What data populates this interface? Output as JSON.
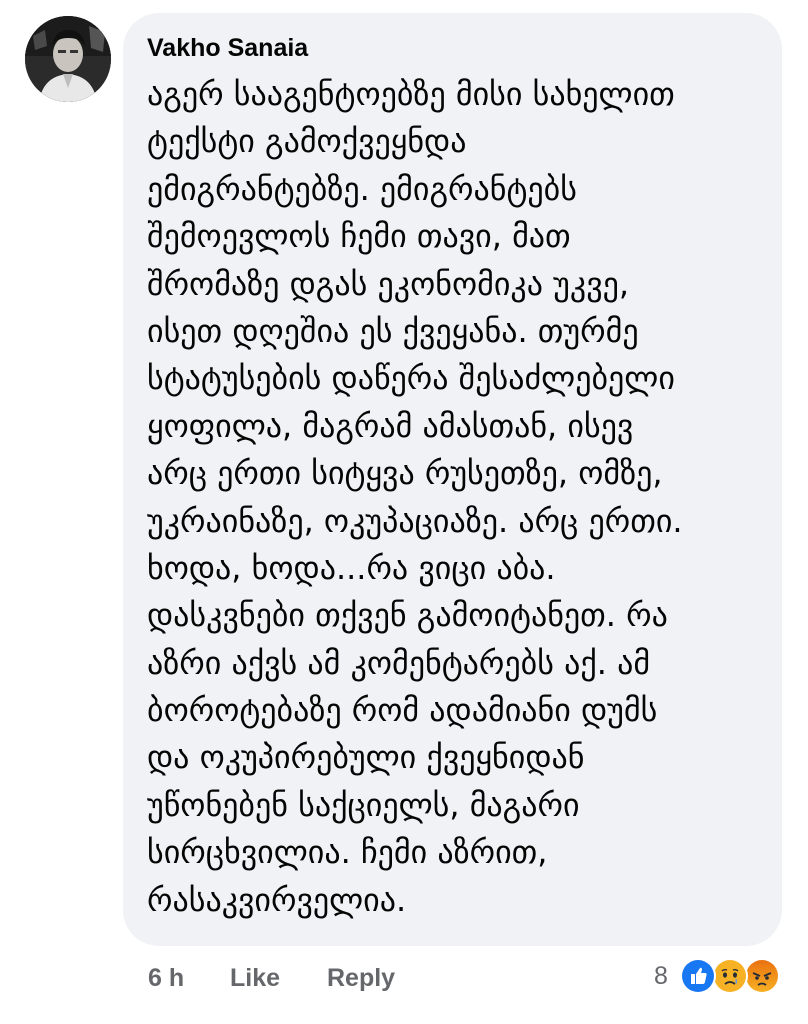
{
  "comment": {
    "author": "Vakho Sanaia",
    "text_lines": [
      "აგერ სააგენტოებზე მისი სახელით",
      "ტექსტი გამოქვეყნდა",
      "ემიგრანტებზე. ემიგრანტებს",
      "შემოევლოს ჩემი თავი, მათ",
      "შრომაზე დგას ეკონომიკა უკვე,",
      "ისეთ დღეშია ეს ქვეყანა. თურმე",
      "სტატუსების დაწერა შესაძლებელი",
      "ყოფილა, მაგრამ ამასთან, ისევ",
      "არც ერთი სიტყვა რუსეთზე, ომზე,",
      "უკრაინაზე, ოკუპაციაზე. არც ერთი.",
      "ხოდა, ხოდა...რა ვიცი აბა.",
      "დასკვნები თქვენ გამოიტანეთ. რა",
      "აზრი აქვს ამ კომენტარებს აქ. ამ",
      "ბოროტებაზე რომ ადამიანი დუმს",
      "და ოკუპირებული ქვეყნიდან",
      "უწონებენ საქციელს, მაგარი",
      "სირცხვილია. ჩემი აზრით,",
      "რასაკვირველია."
    ]
  },
  "actions": {
    "time": "6 h",
    "like_label": "Like",
    "reply_label": "Reply"
  },
  "reactions": {
    "count": "8",
    "icons": [
      "like-reaction-icon",
      "sad-reaction-icon",
      "angry-reaction-icon"
    ]
  },
  "colors": {
    "bubble_bg": "#f0f2f5",
    "meta_text": "#65676b",
    "like_blue": "#1877f2",
    "sad_yellow": "#f7b125",
    "angry_red": "#e9710f"
  }
}
